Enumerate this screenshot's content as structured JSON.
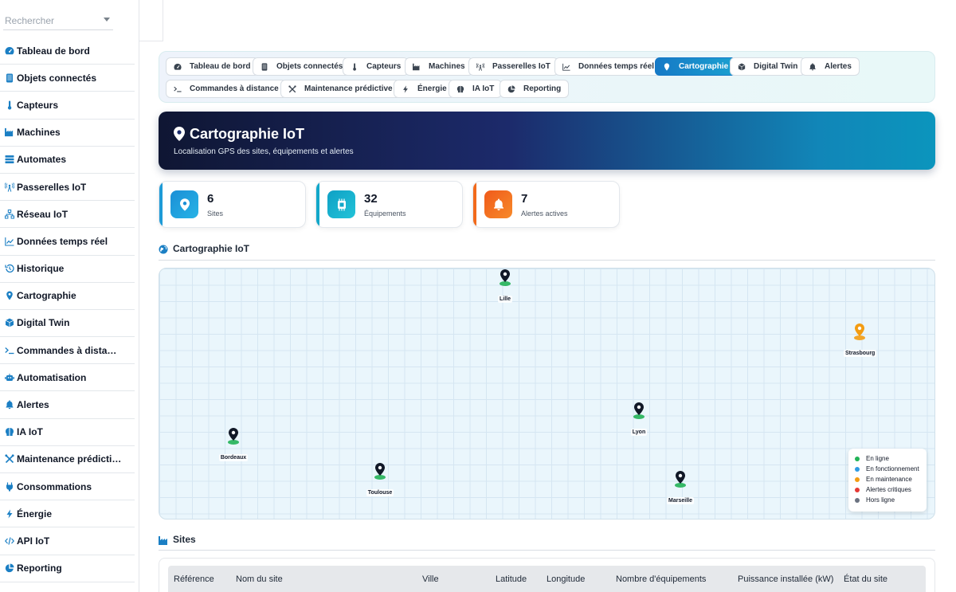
{
  "search": {
    "placeholder": "Rechercher"
  },
  "sidebar": {
    "items": [
      {
        "label": "Tableau de bord",
        "icon": "gauge-icon"
      },
      {
        "label": "Objets connectés",
        "icon": "tablet-icon"
      },
      {
        "label": "Capteurs",
        "icon": "thermometer-icon"
      },
      {
        "label": "Machines",
        "icon": "industry-icon"
      },
      {
        "label": "Automates",
        "icon": "server-icon"
      },
      {
        "label": "Passerelles IoT",
        "icon": "tower-broadcast-icon"
      },
      {
        "label": "Réseau IoT",
        "icon": "network-icon"
      },
      {
        "label": "Données temps réel",
        "icon": "chart-line-icon"
      },
      {
        "label": "Historique",
        "icon": "history-icon"
      },
      {
        "label": "Cartographie",
        "icon": "map-pin-icon"
      },
      {
        "label": "Digital Twin",
        "icon": "cube-icon"
      },
      {
        "label": "Commandes à dista…",
        "icon": "terminal-icon"
      },
      {
        "label": "Automatisation",
        "icon": "robot-icon"
      },
      {
        "label": "Alertes",
        "icon": "bell-icon"
      },
      {
        "label": "IA IoT",
        "icon": "brain-icon"
      },
      {
        "label": "Maintenance prédicti…",
        "icon": "tools-icon"
      },
      {
        "label": "Consommations",
        "icon": "plug-icon"
      },
      {
        "label": "Énergie",
        "icon": "bolt-icon"
      },
      {
        "label": "API IoT",
        "icon": "code-icon"
      },
      {
        "label": "Reporting",
        "icon": "chart-pie-icon"
      }
    ]
  },
  "tabs": [
    {
      "label": "Tableau de bord",
      "icon": "gauge-icon",
      "active": false
    },
    {
      "label": "Objets connectés",
      "icon": "tablet-icon",
      "active": false
    },
    {
      "label": "Capteurs",
      "icon": "thermometer-icon",
      "active": false
    },
    {
      "label": "Machines",
      "icon": "industry-icon",
      "active": false
    },
    {
      "label": "Passerelles IoT",
      "icon": "tower-broadcast-icon",
      "active": false
    },
    {
      "label": "Données temps réel",
      "icon": "chart-line-icon",
      "active": false
    },
    {
      "label": "Cartographie",
      "icon": "map-pin-icon",
      "active": true
    },
    {
      "label": "Digital Twin",
      "icon": "cube-icon",
      "active": false
    },
    {
      "label": "Alertes",
      "icon": "bell-icon",
      "active": false
    },
    {
      "label": "Commandes à distance",
      "icon": "terminal-icon",
      "active": false
    },
    {
      "label": "Maintenance prédictive",
      "icon": "tools-icon",
      "active": false
    },
    {
      "label": "Énergie",
      "icon": "bolt-icon",
      "active": false
    },
    {
      "label": "IA IoT",
      "icon": "brain-icon",
      "active": false
    },
    {
      "label": "Reporting",
      "icon": "chart-pie-icon",
      "active": false
    }
  ],
  "hero": {
    "title": "Cartographie IoT",
    "subtitle": "Localisation GPS des sites, équipements et alertes"
  },
  "stats": [
    {
      "value": "6",
      "label": "Sites",
      "icon": "map-pin-icon",
      "color": "#1e9bd7"
    },
    {
      "value": "32",
      "label": "Équipements",
      "icon": "chip-icon",
      "color": "#12a7c9"
    },
    {
      "value": "7",
      "label": "Alertes actives",
      "icon": "bell-icon",
      "color": "#f26a1b"
    }
  ],
  "map_section": {
    "title": "Cartographie IoT",
    "icon": "globe-icon"
  },
  "map": {
    "markers": [
      {
        "name": "Lille",
        "status": "En ligne",
        "color": "#22b357"
      },
      {
        "name": "Strasbourg",
        "status": "En maintenance",
        "color": "#f39c12"
      },
      {
        "name": "Lyon",
        "status": "En ligne",
        "color": "#22b357"
      },
      {
        "name": "Bordeaux",
        "status": "En ligne",
        "color": "#22b357"
      },
      {
        "name": "Toulouse",
        "status": "En ligne",
        "color": "#22b357"
      },
      {
        "name": "Marseille",
        "status": "En ligne",
        "color": "#22b357"
      }
    ],
    "legend": [
      {
        "label": "En ligne",
        "color": "#22b357"
      },
      {
        "label": "En fonctionnement",
        "color": "#2f9be3"
      },
      {
        "label": "En maintenance",
        "color": "#f39c12"
      },
      {
        "label": "Alertes critiques",
        "color": "#e53935"
      },
      {
        "label": "Hors ligne",
        "color": "#6b7280"
      }
    ]
  },
  "sites_section": {
    "title": "Sites",
    "icon": "industry-icon"
  },
  "table": {
    "headers": [
      "Référence",
      "Nom du site",
      "Ville",
      "Latitude",
      "Longitude",
      "Nombre d'équipements",
      "Puissance installée (kW)",
      "État du site"
    ]
  }
}
